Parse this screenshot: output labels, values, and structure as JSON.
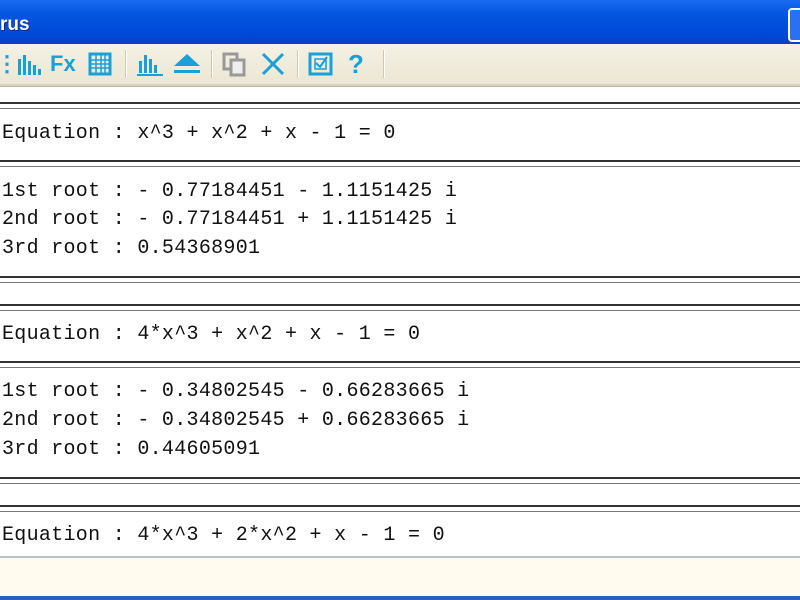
{
  "window": {
    "title": "rus"
  },
  "toolbar": {
    "icons": [
      "statistics-icon",
      "function-icon",
      "table-icon",
      "histogram-icon",
      "eject-icon",
      "copy-icon",
      "clear-icon",
      "checkbox-icon",
      "help-icon"
    ]
  },
  "results": [
    {
      "equation": "Equation : x^3 + x^2 + x - 1 = 0",
      "roots": [
        "1st root : - 0.77184451 - 1.1151425 i",
        "2nd root : - 0.77184451 + 1.1151425 i",
        "3rd root : 0.54368901"
      ]
    },
    {
      "equation": "Equation : 4*x^3 + x^2 + x - 1 = 0",
      "roots": [
        "1st root : - 0.34802545 - 0.66283665 i",
        "2nd root : - 0.34802545 + 0.66283665 i",
        "3rd root : 0.44605091"
      ]
    },
    {
      "equation": "Equation : 4*x^3 + 2*x^2 + x - 1 = 0"
    }
  ]
}
